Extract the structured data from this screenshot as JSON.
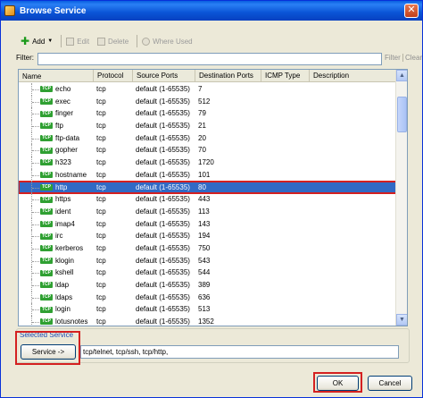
{
  "window": {
    "title": "Browse Service",
    "close_glyph": "✕"
  },
  "toolbar": {
    "add_label": "Add",
    "edit_label": "Edit",
    "delete_label": "Delete",
    "where_used_label": "Where Used"
  },
  "filter": {
    "label": "Filter:",
    "value": "",
    "filter_link": "Filter",
    "clear_link": "Clear"
  },
  "table": {
    "columns": [
      "Name",
      "Protocol",
      "Source Ports",
      "Destination Ports",
      "ICMP Type",
      "Description"
    ],
    "icon_text": "TCP",
    "selected_index": 8,
    "rows": [
      {
        "name": "echo",
        "protocol": "tcp",
        "source": "default (1-65535)",
        "dest": "7",
        "icmp": "",
        "desc": ""
      },
      {
        "name": "exec",
        "protocol": "tcp",
        "source": "default (1-65535)",
        "dest": "512",
        "icmp": "",
        "desc": ""
      },
      {
        "name": "finger",
        "protocol": "tcp",
        "source": "default (1-65535)",
        "dest": "79",
        "icmp": "",
        "desc": ""
      },
      {
        "name": "ftp",
        "protocol": "tcp",
        "source": "default (1-65535)",
        "dest": "21",
        "icmp": "",
        "desc": ""
      },
      {
        "name": "ftp-data",
        "protocol": "tcp",
        "source": "default (1-65535)",
        "dest": "20",
        "icmp": "",
        "desc": ""
      },
      {
        "name": "gopher",
        "protocol": "tcp",
        "source": "default (1-65535)",
        "dest": "70",
        "icmp": "",
        "desc": ""
      },
      {
        "name": "h323",
        "protocol": "tcp",
        "source": "default (1-65535)",
        "dest": "1720",
        "icmp": "",
        "desc": ""
      },
      {
        "name": "hostname",
        "protocol": "tcp",
        "source": "default (1-65535)",
        "dest": "101",
        "icmp": "",
        "desc": ""
      },
      {
        "name": "http",
        "protocol": "tcp",
        "source": "default (1-65535)",
        "dest": "80",
        "icmp": "",
        "desc": ""
      },
      {
        "name": "https",
        "protocol": "tcp",
        "source": "default (1-65535)",
        "dest": "443",
        "icmp": "",
        "desc": ""
      },
      {
        "name": "ident",
        "protocol": "tcp",
        "source": "default (1-65535)",
        "dest": "113",
        "icmp": "",
        "desc": ""
      },
      {
        "name": "imap4",
        "protocol": "tcp",
        "source": "default (1-65535)",
        "dest": "143",
        "icmp": "",
        "desc": ""
      },
      {
        "name": "irc",
        "protocol": "tcp",
        "source": "default (1-65535)",
        "dest": "194",
        "icmp": "",
        "desc": ""
      },
      {
        "name": "kerberos",
        "protocol": "tcp",
        "source": "default (1-65535)",
        "dest": "750",
        "icmp": "",
        "desc": ""
      },
      {
        "name": "klogin",
        "protocol": "tcp",
        "source": "default (1-65535)",
        "dest": "543",
        "icmp": "",
        "desc": ""
      },
      {
        "name": "kshell",
        "protocol": "tcp",
        "source": "default (1-65535)",
        "dest": "544",
        "icmp": "",
        "desc": ""
      },
      {
        "name": "ldap",
        "protocol": "tcp",
        "source": "default (1-65535)",
        "dest": "389",
        "icmp": "",
        "desc": ""
      },
      {
        "name": "ldaps",
        "protocol": "tcp",
        "source": "default (1-65535)",
        "dest": "636",
        "icmp": "",
        "desc": ""
      },
      {
        "name": "login",
        "protocol": "tcp",
        "source": "default (1-65535)",
        "dest": "513",
        "icmp": "",
        "desc": ""
      },
      {
        "name": "lotusnotes",
        "protocol": "tcp",
        "source": "default (1-65535)",
        "dest": "1352",
        "icmp": "",
        "desc": ""
      }
    ]
  },
  "selected_service": {
    "legend": "Selected Service",
    "button_label": "Service ->",
    "value": "tcp/telnet, tcp/ssh, tcp/http,"
  },
  "footer": {
    "ok_label": "OK",
    "cancel_label": "Cancel"
  },
  "colors": {
    "selection": "#316ac5",
    "highlight_box": "#d42020",
    "service_icon": "#2fa032",
    "titlebar": "#0a54d6"
  }
}
